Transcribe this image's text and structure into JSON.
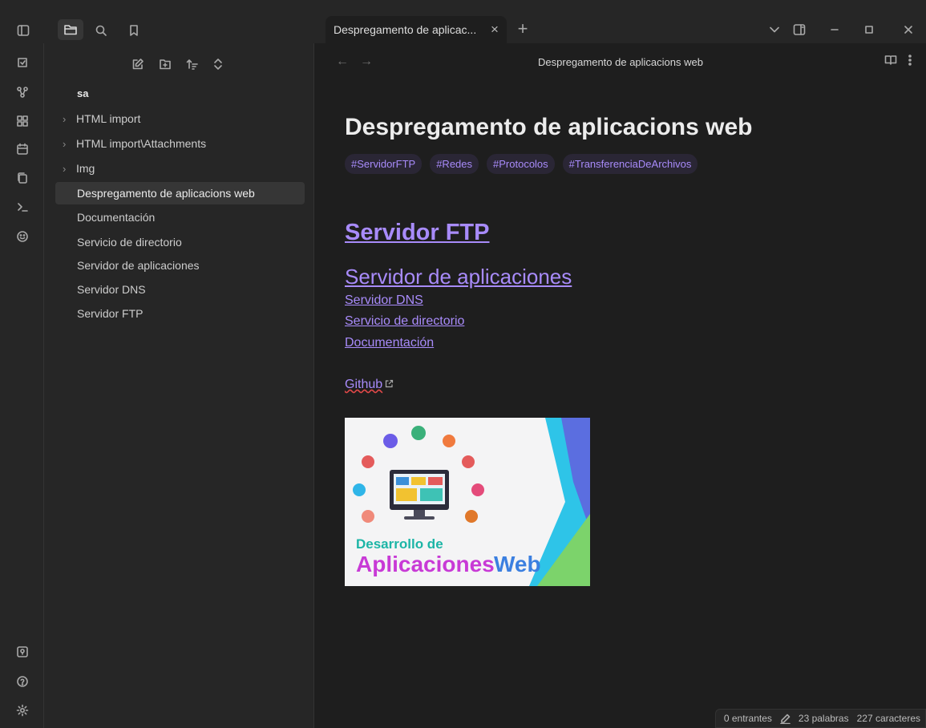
{
  "titlebar": {
    "tab_title": "Despregamento de aplicac...",
    "tab_close": "×",
    "new_tab": "+"
  },
  "sidebar": {
    "root": "sa",
    "items": [
      {
        "label": "HTML import",
        "type": "folder"
      },
      {
        "label": "HTML import\\Attachments",
        "type": "folder"
      },
      {
        "label": "Img",
        "type": "folder"
      },
      {
        "label": "Despregamento de aplicacions web",
        "type": "file",
        "active": true
      },
      {
        "label": "Documentación",
        "type": "file"
      },
      {
        "label": "Servicio de directorio",
        "type": "file"
      },
      {
        "label": "Servidor de aplicaciones",
        "type": "file"
      },
      {
        "label": "Servidor DNS",
        "type": "file"
      },
      {
        "label": "Servidor FTP",
        "type": "file"
      }
    ]
  },
  "view": {
    "title": "Despregamento de aplicacions web"
  },
  "doc": {
    "heading": "Despregamento de aplicacions web",
    "tags": [
      "#ServidorFTP",
      "#Redes",
      "#Protocolos",
      "#TransferenciaDeArchivos"
    ],
    "h2_link": "Servidor FTP",
    "h3_link": "Servidor de aplicaciones",
    "links": [
      "Servidor DNS",
      "Servicio de directorio",
      "Documentación"
    ],
    "external_link": "Github",
    "banner_text_line1": "Desarrollo de",
    "banner_text_line2a": "Aplicaciones",
    "banner_text_line2b": "Web"
  },
  "status": {
    "backlinks": "0 entrantes",
    "words": "23 palabras",
    "chars": "227 caracteres"
  },
  "colors": {
    "accent": "#a88bfa",
    "bg": "#1e1e1e",
    "panel": "#262626"
  }
}
